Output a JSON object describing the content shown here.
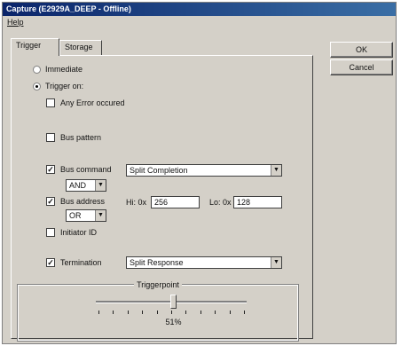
{
  "window": {
    "title": "Capture (E2929A_DEEP - Offline)"
  },
  "menu": {
    "help": "Help"
  },
  "tabs": [
    "Trigger",
    "Storage"
  ],
  "buttons": {
    "ok": "OK",
    "cancel": "Cancel"
  },
  "trigger_mode": {
    "immediate": "Immediate",
    "trigger_on": "Trigger on:",
    "selected": "trigger_on"
  },
  "options": {
    "any_error": {
      "label": "Any Error occured",
      "checked": false
    },
    "bus_pattern": {
      "label": "Bus pattern",
      "checked": false
    },
    "bus_command": {
      "label": "Bus command",
      "checked": true,
      "value": "Split Completion",
      "operator": "AND"
    },
    "bus_address": {
      "label": "Bus address",
      "checked": true,
      "operator": "OR",
      "hi_label": "Hi: 0x",
      "hi_value": "256",
      "lo_label": "Lo: 0x",
      "lo_value": "128"
    },
    "initiator_id": {
      "label": "Initiator ID",
      "checked": false
    },
    "termination": {
      "label": "Termination",
      "checked": true,
      "value": "Split Response"
    }
  },
  "triggerpoint": {
    "title": "Triggerpoint",
    "value": 0.51,
    "display": "51%"
  },
  "icons": {
    "dropdown": "chevron-down-icon",
    "check": "check-icon"
  }
}
